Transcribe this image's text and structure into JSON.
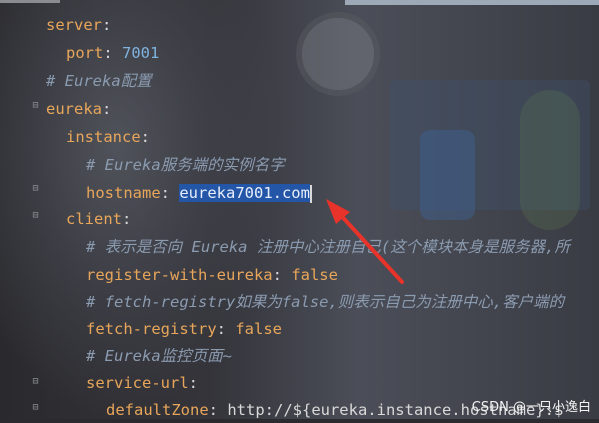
{
  "editor": {
    "lines": [
      {
        "indent": 1,
        "key": "server",
        "sep": ":",
        "value": ""
      },
      {
        "indent": 2,
        "key": "port",
        "sep": ": ",
        "value": "7001",
        "value_type": "number"
      },
      {
        "indent": 1,
        "comment": "# Eureka配置"
      },
      {
        "indent": 0,
        "key": "eureka",
        "sep": ":",
        "value": ""
      },
      {
        "indent": 2,
        "key": "instance",
        "sep": ":",
        "value": ""
      },
      {
        "indent": 3,
        "comment": "# Eureka服务端的实例名字"
      },
      {
        "indent": 3,
        "key": "hostname",
        "sep": ": ",
        "value": "eureka7001.com",
        "selected": true
      },
      {
        "indent": 2,
        "key": "client",
        "sep": ":",
        "value": ""
      },
      {
        "indent": 3,
        "comment": "# 表示是否向 Eureka 注册中心注册自己(这个模块本身是服务器,所"
      },
      {
        "indent": 3,
        "key": "register-with-eureka",
        "sep": ": ",
        "value": "false",
        "value_type": "bool"
      },
      {
        "indent": 3,
        "comment": "# fetch-registry如果为false,则表示自己为注册中心,客户端的"
      },
      {
        "indent": 3,
        "key": "fetch-registry",
        "sep": ": ",
        "value": "false",
        "value_type": "bool"
      },
      {
        "indent": 3,
        "comment": "# Eureka监控页面~"
      },
      {
        "indent": 3,
        "key": "service-url",
        "sep": ":",
        "value": ""
      },
      {
        "indent": 4,
        "key": "defaultZone",
        "sep": ": ",
        "value": "http://${eureka.instance.hostname}:$"
      }
    ]
  },
  "watermark": "CSDN @一只小逸白",
  "colors": {
    "key": "#e8a65a",
    "comment": "#8b9bb0",
    "number": "#7fb3e0",
    "selection": "#2456a8",
    "arrow": "#e8332a"
  }
}
